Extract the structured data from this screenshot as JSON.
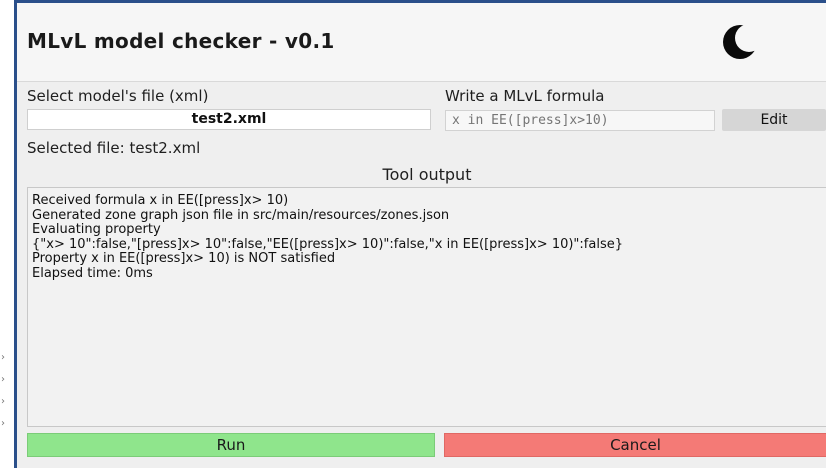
{
  "window": {
    "title": "MLvL model checker - v0.1"
  },
  "model_section": {
    "label": "Select model's file (xml)",
    "file_name": "test2.xml",
    "selected_text": "Selected file: test2.xml"
  },
  "formula_section": {
    "label": "Write a MLvL formula",
    "placeholder": "x in EE([press]x>10)",
    "value": "",
    "edit_label": "Edit"
  },
  "output": {
    "title": "Tool output",
    "lines": [
      "Received formula x in EE([press]x> 10)",
      "Generated zone graph json file in src/main/resources/zones.json",
      "Evaluating property",
      "{\"x> 10\":false,\"[press]x> 10\":false,\"EE([press]x> 10)\":false,\"x in EE([press]x> 10)\":false}",
      "Property x in EE([press]x> 10) is NOT satisfied",
      "Elapsed time: 0ms"
    ]
  },
  "actions": {
    "run_label": "Run",
    "cancel_label": "Cancel"
  },
  "icons": {
    "theme_toggle": "moon-icon"
  },
  "colors": {
    "accent_border": "#2a4f8a",
    "run": "#8fe58c",
    "cancel": "#f47a76",
    "edit": "#d6d6d6"
  }
}
